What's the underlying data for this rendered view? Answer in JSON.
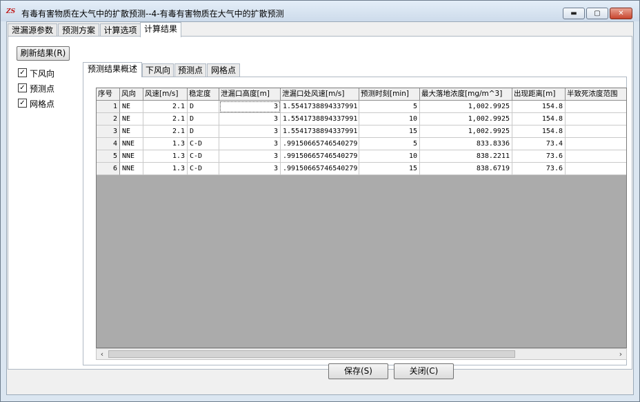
{
  "window": {
    "icon_text": "ZS",
    "title": "有毒有害物质在大气中的扩散预测--4-有毒有害物质在大气中的扩散预测"
  },
  "tabs": [
    "泄漏源参数",
    "预测方案",
    "计算选项",
    "计算结果"
  ],
  "active_tab": "计算结果",
  "left_panel": {
    "refresh_label": "刷新结果(R)",
    "checkboxes": [
      {
        "label": "下风向",
        "checked": true
      },
      {
        "label": "预测点",
        "checked": true
      },
      {
        "label": "网格点",
        "checked": true
      }
    ]
  },
  "subtabs": [
    "预测结果概述",
    "下风向",
    "预测点",
    "网格点"
  ],
  "active_subtab": "预测结果概述",
  "table": {
    "columns": [
      "序号",
      "风向",
      "风速[m/s]",
      "稳定度",
      "泄漏口高度[m]",
      "泄漏口处风速[m/s]",
      "预测时刻[min]",
      "最大落地浓度[mg/m^3]",
      "出现距离[m]",
      "半致死浓度范围"
    ],
    "rows": [
      [
        "1",
        "NE",
        "2.1",
        "D",
        "3",
        "1.5541738894337991",
        "5",
        "1,002.9925",
        "154.8",
        ""
      ],
      [
        "2",
        "NE",
        "2.1",
        "D",
        "3",
        "1.5541738894337991",
        "10",
        "1,002.9925",
        "154.8",
        ""
      ],
      [
        "3",
        "NE",
        "2.1",
        "D",
        "3",
        "1.5541738894337991",
        "15",
        "1,002.9925",
        "154.8",
        ""
      ],
      [
        "4",
        "NNE",
        "1.3",
        "C-D",
        "3",
        ".99150665746540279",
        "5",
        "833.8336",
        "73.4",
        ""
      ],
      [
        "5",
        "NNE",
        "1.3",
        "C-D",
        "3",
        ".99150665746540279",
        "10",
        "838.2211",
        "73.6",
        ""
      ],
      [
        "6",
        "NNE",
        "1.3",
        "C-D",
        "3",
        ".99150665746540279",
        "15",
        "838.6719",
        "73.6",
        ""
      ]
    ]
  },
  "buttons": {
    "save_label": "保存(S)",
    "close_label": "关闭(C)"
  },
  "colors": {
    "grid_background": "#ababab",
    "title_bar": "#dbe6f1",
    "close_button": "#c8452e"
  }
}
